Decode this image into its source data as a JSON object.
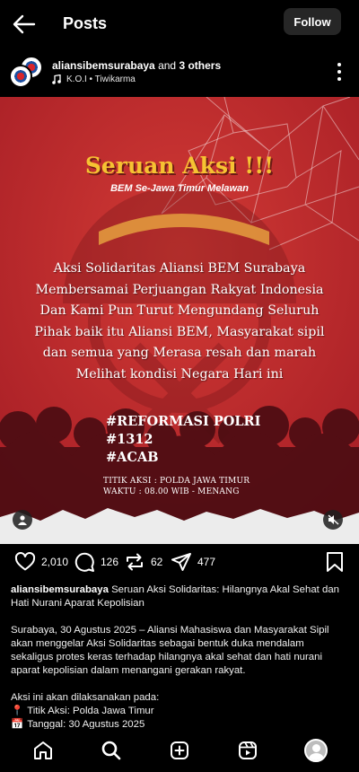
{
  "topbar": {
    "title": "Posts",
    "follow_label": "Follow"
  },
  "post": {
    "author": "aliansibemsurabaya",
    "coauthors_text": " and ",
    "coauthors_count": "3 others",
    "music": "K.O.I • Tiwikarma"
  },
  "image": {
    "headline": "Seruan Aksi !!!",
    "subheadline": "BEM Se-Jawa Timur Melawan",
    "body_lines": [
      "Aksi Solidaritas Aliansi BEM Surabaya",
      "Membersamai Perjuangan  Rakyat Indonesia",
      "Dan Kami Pun Turut Mengundang Seluruh",
      "Pihak baik itu Aliansi BEM, Masyarakat sipil",
      "dan semua yang Merasa resah dan marah",
      "Melihat kondisi Negara Hari ini"
    ],
    "hashtags": [
      "#REFORMASI POLRI",
      "#1312",
      "#ACAB"
    ],
    "location_line": "TITIK AKSI : POLDA JAWA TIMUR",
    "time_line": "WAKTU : 08.00 WIB - MENANG"
  },
  "actions": {
    "likes": "2,010",
    "comments": "126",
    "reposts": "62",
    "shares": "477"
  },
  "caption": {
    "username": "aliansibemsurabaya",
    "headline": " Seruan Aksi Solidaritas: Hilangnya Akal Sehat dan Hati Nurani Aparat Kepolisian",
    "paragraph": "Surabaya, 30 Agustus 2025 – Aliansi Mahasiswa dan Masyarakat Sipil akan menggelar Aksi Solidaritas sebagai bentuk duka mendalam sekaligus protes keras terhadap hilangnya akal sehat dan hati nurani aparat kepolisian dalam menangani gerakan rakyat.",
    "intro": "Aksi ini akan dilaksanakan pada:",
    "location_icon": "📍",
    "location": "Titik Aksi: Polda Jawa Timur",
    "date_icon": "📅",
    "date": "Tanggal: 30 Agustus 2025"
  },
  "icons": {
    "back": "arrow-left-icon",
    "music": "music-note-icon",
    "more": "kebab-icon",
    "like": "heart-icon",
    "comment": "comment-icon",
    "repost": "repost-icon",
    "share": "send-icon",
    "bookmark": "bookmark-icon",
    "user_tag": "user-tag-icon",
    "mute": "speaker-muted-icon",
    "nav": [
      "home-icon",
      "search-icon",
      "create-icon",
      "reels-icon",
      "profile-avatar"
    ]
  },
  "colors": {
    "background": "#000000",
    "poster_red": "#c0282d",
    "headline_yellow": "#f6c232",
    "follow_bg": "#262626"
  }
}
